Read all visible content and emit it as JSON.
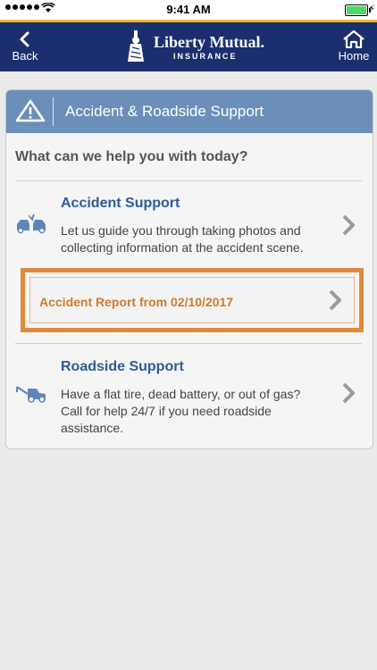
{
  "status_bar": {
    "time": "9:41 AM"
  },
  "nav": {
    "back_label": "Back",
    "home_label": "Home",
    "logo_title": "Liberty Mutual.",
    "logo_subtitle": "INSURANCE"
  },
  "card": {
    "title": "Accident & Roadside Support",
    "prompt": "What can we help you with today?",
    "accident": {
      "title": "Accident Support",
      "description": "Let us guide you through taking photos and collecting information at the accident scene."
    },
    "report": {
      "label": "Accident Report from 02/10/2017"
    },
    "roadside": {
      "title": "Roadside Support",
      "description": "Have a flat tire, dead battery, or out of gas? Call for help 24/7 if you need roadside assistance."
    }
  },
  "colors": {
    "nav_background": "#1b2f6e",
    "accent_line": "#f2b830",
    "card_header": "#6b8fb8",
    "section_title": "#2f5b98",
    "report_highlight": "#e08a3b"
  },
  "icons": {
    "signal": "signal-dots-icon",
    "wifi": "wifi-icon",
    "battery": "battery-icon",
    "back": "chevron-left-icon",
    "home": "home-icon",
    "warning": "warning-triangle-icon",
    "crash": "car-crash-icon",
    "tow": "tow-truck-icon",
    "chevron": "chevron-right-icon"
  }
}
